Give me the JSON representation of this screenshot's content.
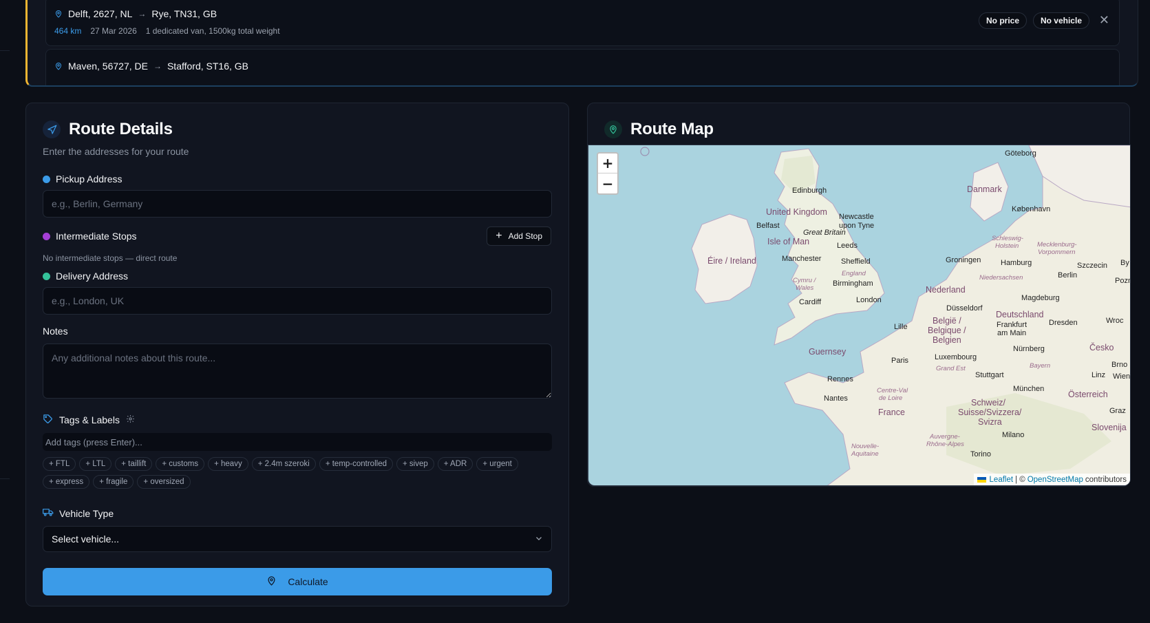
{
  "routes": [
    {
      "from": "Delft, 2627, NL",
      "to": "Rye, TN31, GB",
      "distance": "464 km",
      "date": "27 Mar 2026",
      "details": "1 dedicated van, 1500kg total weight",
      "price_badge": "No price",
      "vehicle_badge": "No vehicle"
    },
    {
      "from": "Maven, 56727, DE",
      "to": "Stafford, ST16, GB"
    }
  ],
  "details": {
    "title": "Route Details",
    "subtitle": "Enter the addresses for your route",
    "pickup_label": "Pickup Address",
    "pickup_placeholder": "e.g., Berlin, Germany",
    "stops_label": "Intermediate Stops",
    "add_stop_label": "Add Stop",
    "no_stops_text": "No intermediate stops — direct route",
    "delivery_label": "Delivery Address",
    "delivery_placeholder": "e.g., London, UK",
    "notes_label": "Notes",
    "notes_placeholder": "Any additional notes about this route...",
    "tags_label": "Tags & Labels",
    "tags_placeholder": "Add tags (press Enter)...",
    "tag_suggestions": [
      "+ FTL",
      "+ LTL",
      "+ taillift",
      "+ customs",
      "+ heavy",
      "+ 2.4m szeroki",
      "+ temp-controlled",
      "+ sivep",
      "+ ADR",
      "+ urgent",
      "+ express",
      "+ fragile",
      "+ oversized"
    ],
    "vehicle_label": "Vehicle Type",
    "vehicle_selected": "Select vehicle...",
    "calculate_label": "Calculate"
  },
  "map": {
    "title": "Route Map",
    "zoom_in": "+",
    "zoom_out": "−",
    "attribution_leaflet": "Leaflet",
    "attribution_sep": "| ©",
    "attribution_osm": "OpenStreetMap",
    "attribution_tail": "contributors",
    "labels": {
      "goteborg": "Göteborg",
      "danmark": "Danmark",
      "kobenhavn": "København",
      "edinburgh": "Edinburgh",
      "uk": "United Kingdom",
      "newcastle1": "Newcastle",
      "newcastle2": "upon Tyne",
      "belfast": "Belfast",
      "great_britain": "Great Britain",
      "isle_of_man": "Isle of Man",
      "leeds": "Leeds",
      "eire": "Éire / Ireland",
      "manchester": "Manchester",
      "sheffield": "Sheffield",
      "england": "England",
      "cymru1": "Cymru /",
      "cymru2": "Wales",
      "birmingham": "Birmingham",
      "cardiff": "Cardiff",
      "london": "London",
      "schleswig1": "Schleswig-",
      "schleswig2": "Holstein",
      "mecklenburg1": "Mecklenburg-",
      "mecklenburg2": "Vorpommern",
      "groningen": "Groningen",
      "hamburg": "Hamburg",
      "szczecin": "Szczecin",
      "niedersachsen": "Niedersachsen",
      "berlin": "Berlin",
      "poznan": "Pozn",
      "nederland": "Nederland",
      "magdeburg": "Magdeburg",
      "dusseldorf": "Düsseldorf",
      "deutschland": "Deutschland",
      "belgie1": "België /",
      "belgie2": "Belgique /",
      "belgie3": "Belgien",
      "lille": "Lille",
      "frankfurt1": "Frankfurt",
      "frankfurt2": "am Main",
      "dresden": "Dresden",
      "wroc": "Wroc",
      "guernsey": "Guernsey",
      "paris": "Paris",
      "luxembourg": "Luxembourg",
      "nurnberg": "Nürnberg",
      "cesko": "Česko",
      "grand_est": "Grand Est",
      "bayern": "Bayern",
      "brno": "Brno",
      "rennes": "Rennes",
      "stuttgart": "Stuttgart",
      "linz": "Linz",
      "wien": "Wien",
      "centre1": "Centre-Val",
      "centre2": "de Loire",
      "munchen": "München",
      "osterreich": "Österreich",
      "nantes": "Nantes",
      "schweiz1": "Schweiz/",
      "schweiz2": "Suisse/Svizzera/",
      "schweiz3": "Svizra",
      "graz": "Graz",
      "france": "France",
      "slovenija": "Slovenija",
      "milano": "Milano",
      "nouvelle1": "Nouvelle-",
      "nouvelle2": "Aquitaine",
      "auvergne1": "Auvergne-",
      "auvergne2": "Rhône-Alpes",
      "torino": "Torino",
      "by": "By"
    }
  },
  "colors": {
    "accent": "#3b9be8",
    "pickup_dot": "#3b9be8",
    "stops_dot": "#a53fd6",
    "delivery_dot": "#34c29a",
    "panel_border_accent": "#f2b632",
    "sea": "#aad3df",
    "land": "#f2efe9"
  }
}
